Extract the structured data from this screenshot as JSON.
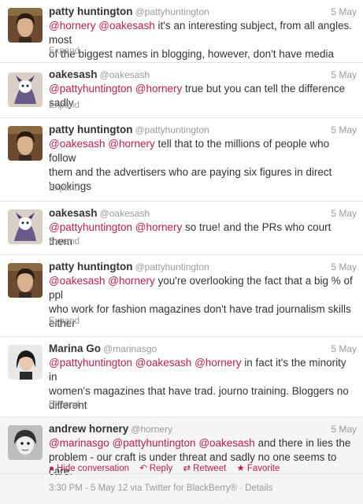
{
  "tweets": [
    {
      "name": "patty huntington",
      "handle": "@pattyhuntington",
      "time": "5 May",
      "lines": [
        [
          {
            "m": "@hornery"
          },
          {
            "t": " "
          },
          {
            "m": "@oakesash"
          },
          {
            "t": " it's an interesting subject, from all angles. most"
          }
        ],
        [
          {
            "t": "of the biggest names in blogging, however, don't have media training"
          }
        ]
      ],
      "expand": "Expand"
    },
    {
      "name": "oakesash",
      "handle": "@oakesash",
      "time": "5 May",
      "lines": [
        [
          {
            "m": "@pattyhuntington"
          },
          {
            "t": " "
          },
          {
            "m": "@hornery"
          },
          {
            "t": " true but you can tell the difference sadly"
          }
        ]
      ],
      "expand": "Expand"
    },
    {
      "name": "patty huntington",
      "handle": "@pattyhuntington",
      "time": "5 May",
      "lines": [
        [
          {
            "m": "@oakesash"
          },
          {
            "t": " "
          },
          {
            "m": "@hornery"
          },
          {
            "t": " tell that to the millions of people who follow"
          }
        ],
        [
          {
            "t": "them and the advertisers who are paying six figures in direct"
          }
        ],
        [
          {
            "t": "bookings"
          }
        ]
      ],
      "expand": "Expand"
    },
    {
      "name": "oakesash",
      "handle": "@oakesash",
      "time": "5 May",
      "lines": [
        [
          {
            "m": "@pattyhuntington"
          },
          {
            "t": " "
          },
          {
            "m": "@hornery"
          },
          {
            "t": " so true! and the PRs who court them"
          }
        ]
      ],
      "expand": "Expand"
    },
    {
      "name": "patty huntington",
      "handle": "@pattyhuntington",
      "time": "5 May",
      "lines": [
        [
          {
            "m": "@oakesash"
          },
          {
            "t": " "
          },
          {
            "m": "@hornery"
          },
          {
            "t": " you're overlooking the fact that a big % of ppl"
          }
        ],
        [
          {
            "t": "who work for fashion magazines don't have trad journalism skills"
          }
        ],
        [
          {
            "t": "either"
          }
        ]
      ],
      "expand": "Expand"
    },
    {
      "name": "Marina Go",
      "handle": "@marinasgo",
      "time": "5 May",
      "lines": [
        [
          {
            "m": "@pattyhuntington"
          },
          {
            "t": " "
          },
          {
            "m": "@oakesash"
          },
          {
            "t": " "
          },
          {
            "m": "@hornery"
          },
          {
            "t": " in fact it's the minority in"
          }
        ],
        [
          {
            "t": "women's magazines that have trad. journo training. Bloggers no"
          }
        ],
        [
          {
            "t": "different"
          }
        ]
      ],
      "expand": "Expand"
    },
    {
      "name": "andrew hornery",
      "handle": "@hornery",
      "time": "5 May",
      "lines": [
        [
          {
            "m": "@marinasgo"
          },
          {
            "t": " "
          },
          {
            "m": "@pattyhuntington"
          },
          {
            "t": " "
          },
          {
            "m": "@oakesash"
          },
          {
            "t": " and there in lies the"
          }
        ],
        [
          {
            "t": "problem - our craft is under threat and sadly no one seems to care."
          }
        ]
      ],
      "expand": ""
    }
  ],
  "actions": {
    "hide": "Hide conversation",
    "reply": "Reply",
    "retweet": "Retweet",
    "favorite": "Favorite"
  },
  "meta": "3:30 PM - 5 May 12 via Twitter for BlackBerry® · Details",
  "colors": {
    "mention": "#b8204a",
    "muted": "#999999",
    "text": "#333333"
  }
}
